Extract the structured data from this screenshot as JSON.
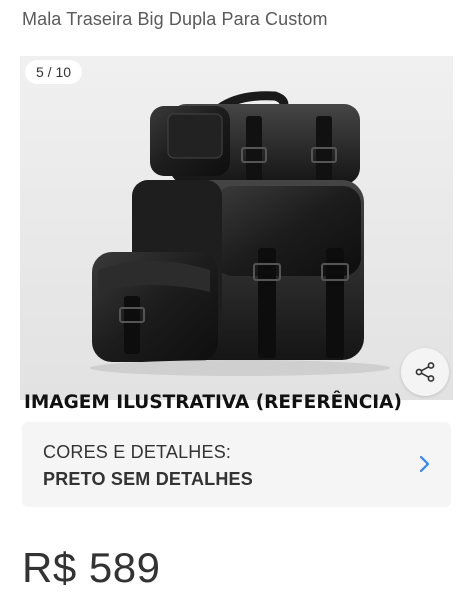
{
  "product": {
    "title": "Mala Traseira Big Dupla Para Custom"
  },
  "gallery": {
    "counter": "5 / 10",
    "image_icon": "black-leather-saddlebag-photo",
    "share_icon": "share-icon"
  },
  "caption": "IMAGEM ILUSTRATIVA (REFERÊNCIA)",
  "variant": {
    "label": "CORES E DETALHES:",
    "value": "PRETO SEM DETALHES",
    "chevron_icon": "chevron-right-icon",
    "accent": "#3483fa"
  },
  "price": {
    "currency": "R$",
    "amount": "589"
  }
}
